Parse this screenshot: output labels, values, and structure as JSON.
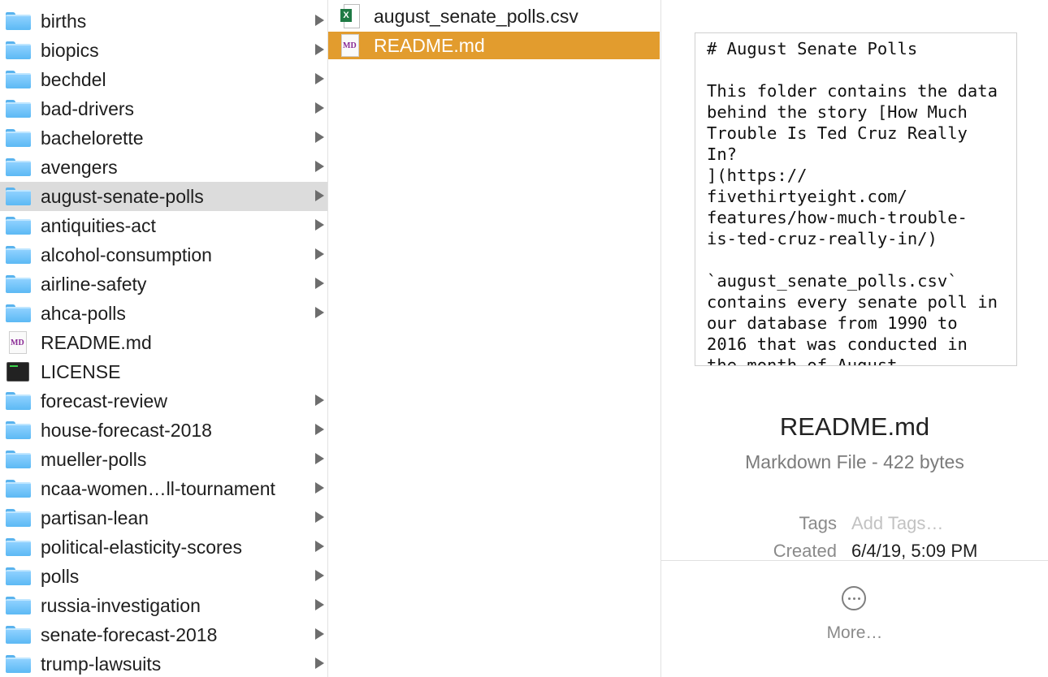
{
  "column1": {
    "items": [
      {
        "label": "births",
        "type": "folder",
        "arrow": true
      },
      {
        "label": "biopics",
        "type": "folder",
        "arrow": true
      },
      {
        "label": "bechdel",
        "type": "folder",
        "arrow": true
      },
      {
        "label": "bad-drivers",
        "type": "folder",
        "arrow": true
      },
      {
        "label": "bachelorette",
        "type": "folder",
        "arrow": true
      },
      {
        "label": "avengers",
        "type": "folder",
        "arrow": true
      },
      {
        "label": "august-senate-polls",
        "type": "folder",
        "arrow": true,
        "highlighted": true
      },
      {
        "label": "antiquities-act",
        "type": "folder",
        "arrow": true
      },
      {
        "label": "alcohol-consumption",
        "type": "folder",
        "arrow": true
      },
      {
        "label": "airline-safety",
        "type": "folder",
        "arrow": true
      },
      {
        "label": "ahca-polls",
        "type": "folder",
        "arrow": true
      },
      {
        "label": "README.md",
        "type": "markdown",
        "arrow": false
      },
      {
        "label": "LICENSE",
        "type": "terminal",
        "arrow": false
      },
      {
        "label": "forecast-review",
        "type": "folder",
        "arrow": true
      },
      {
        "label": "house-forecast-2018",
        "type": "folder",
        "arrow": true
      },
      {
        "label": "mueller-polls",
        "type": "folder",
        "arrow": true
      },
      {
        "label": "ncaa-women…ll-tournament",
        "type": "folder",
        "arrow": true
      },
      {
        "label": "partisan-lean",
        "type": "folder",
        "arrow": true
      },
      {
        "label": "political-elasticity-scores",
        "type": "folder",
        "arrow": true
      },
      {
        "label": "polls",
        "type": "folder",
        "arrow": true
      },
      {
        "label": "russia-investigation",
        "type": "folder",
        "arrow": true
      },
      {
        "label": "senate-forecast-2018",
        "type": "folder",
        "arrow": true
      },
      {
        "label": "trump-lawsuits",
        "type": "folder",
        "arrow": true
      }
    ]
  },
  "column2": {
    "items": [
      {
        "label": "august_senate_polls.csv",
        "type": "spreadsheet",
        "selected": false
      },
      {
        "label": "README.md",
        "type": "markdown",
        "selected": true
      }
    ]
  },
  "preview": {
    "text": "# August Senate Polls\n\nThis folder contains the data behind the story [How Much Trouble Is Ted Cruz Really In?\n](https://\nfivethirtyeight.com/\nfeatures/how-much-trouble-\nis-ted-cruz-really-in/)\n\n`august_senate_polls.csv`\ncontains every senate poll in our database from 1990 to 2016 that was conducted in the month of August",
    "file_name": "README.md",
    "file_kind": "Markdown File - 422 bytes",
    "tags_label": "Tags",
    "tags_placeholder": "Add Tags…",
    "created_label": "Created",
    "created_value": "6/4/19, 5:09 PM",
    "more_label": "More…"
  },
  "colors": {
    "selection": "#e29c2e",
    "row_highlight": "#dcdcdc",
    "folder": "#5cb9f4"
  }
}
